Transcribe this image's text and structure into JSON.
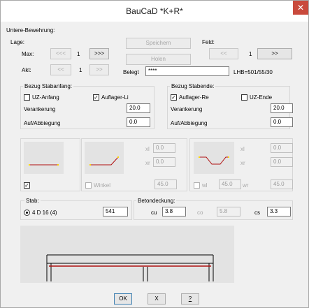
{
  "window": {
    "title": "BauCaD *K+R*",
    "close_glyph": "✕"
  },
  "untere": {
    "header": "Untere-Bewehrung:",
    "lage_label": "Lage:",
    "max_label": "Max:",
    "akt_label": "Akt:",
    "max_prev": "<<<",
    "max_value": "1",
    "max_next": ">>>",
    "akt_prev": "<<",
    "akt_value": "1",
    "akt_next": ">>",
    "speichern": "Speichern",
    "holen": "Holen",
    "feld_label": "Feld:",
    "feld_prev": "<<",
    "feld_value": "1",
    "feld_next": ">>",
    "belegt_label": "Belegt",
    "belegt_value": "****",
    "lhb": "LHB=501/55/30"
  },
  "stabanfang": {
    "header": "Bezug Stabanfang:",
    "uz_label": "UZ-Anfang",
    "uz_checked": false,
    "auflager_label": "Auflager-Li",
    "auflager_checked": true,
    "verankerung_label": "Verankerung",
    "verankerung_value": "20.0",
    "aufabbiegung_label": "Auf/Abbiegung",
    "aufabbiegung_value": "0.0"
  },
  "stabende": {
    "header": "Bezug Stabende:",
    "auflager_label": "Auflager-Re",
    "auflager_checked": true,
    "uz_label": "UZ-Ende",
    "uz_checked": false,
    "verankerung_label": "Verankerung",
    "verankerung_value": "20.0",
    "aufabbiegung_label": "Auf/Abbiegung",
    "aufabbiegung_value": "0.0"
  },
  "shapes": {
    "straight_checked": true,
    "bent_xl_label": "xl",
    "bent_xl_value": "0.0",
    "bent_xr_label": "xr",
    "bent_xr_value": "0.0",
    "winkel_label": "Winkel",
    "winkel_value": "45.0",
    "double_xl_label": "xl",
    "double_xl_value": "0.0",
    "double_xr_label": "xr",
    "double_xr_value": "0.0",
    "wl_label": "wl",
    "wl_value": "45.0",
    "wr_label": "wr",
    "wr_value": "45.0"
  },
  "stab": {
    "label": "Stab:",
    "option": "4 D 16 (4)",
    "value": "541"
  },
  "betondeckung": {
    "label": "Betondeckung:",
    "cu_label": "cu",
    "cu_value": "3.8",
    "co_label": "co",
    "co_value": "5.8",
    "cs_label": "cs",
    "cs_value": "3.3"
  },
  "colors": {
    "rebar": "#b01010",
    "accent_rebar": "#ffd400"
  },
  "buttons": {
    "ok": "OK",
    "cancel": "X",
    "help": "?"
  }
}
